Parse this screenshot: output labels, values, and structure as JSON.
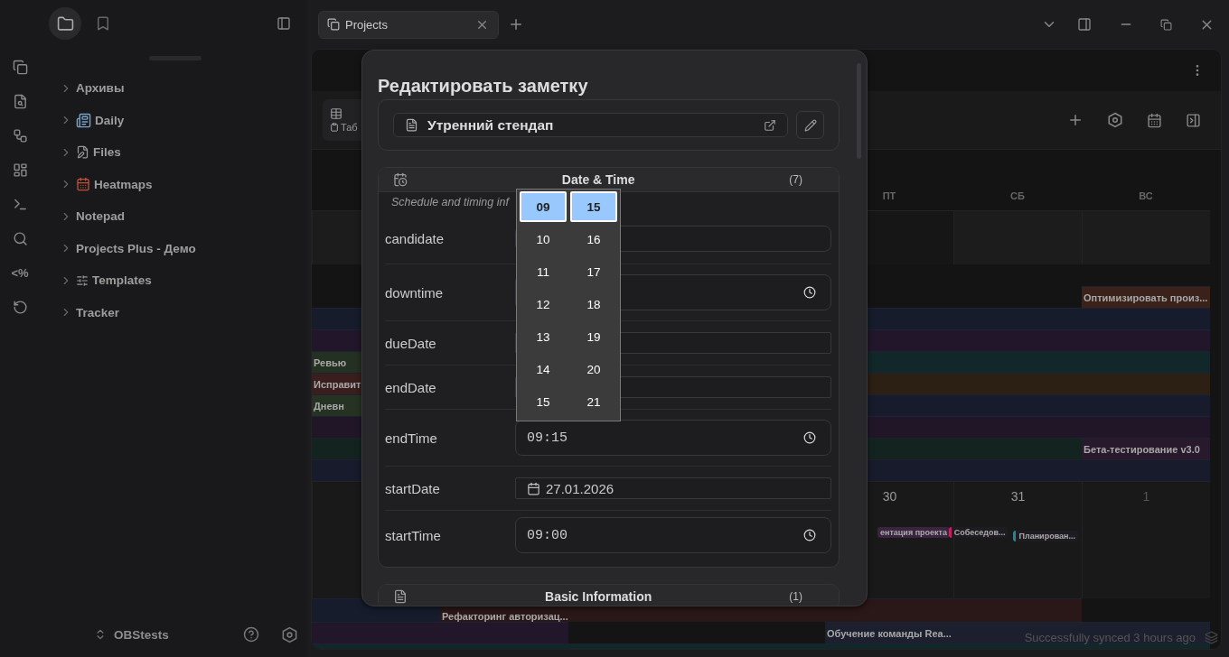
{
  "ribbon": {
    "template_glyph": "<%"
  },
  "sidebar": {
    "tabs": [
      {
        "kind": "files",
        "selected": true
      },
      {
        "kind": "bookmarks",
        "selected": false
      }
    ],
    "tree": [
      {
        "label": "Архивы",
        "kind": "plain",
        "expanded": false
      },
      {
        "label": "Daily",
        "kind": "daily",
        "expanded": false
      },
      {
        "label": "Files",
        "kind": "files",
        "expanded": false
      },
      {
        "label": "Heatmaps",
        "kind": "heatmap",
        "expanded": false
      },
      {
        "label": "Notepad",
        "kind": "plain",
        "expanded": false
      },
      {
        "label": "Projects Plus - Демо",
        "kind": "plain",
        "expanded": false
      },
      {
        "label": "Templates",
        "kind": "templates",
        "expanded": false
      },
      {
        "label": "Tracker",
        "kind": "plain",
        "expanded": false
      }
    ],
    "vault": "OBStests"
  },
  "tabs": [
    {
      "label": "Projects",
      "selected": true
    }
  ],
  "toolbar": {
    "view_label": "Таб"
  },
  "calendar": {
    "weekdays": [
      "ПТ",
      "СБ",
      "ВС"
    ],
    "lanes": [
      {
        "segments": [
          {
            "color": "#3a2119",
            "label": "Оптимизировать произ..."
          }
        ]
      },
      {
        "segments": [
          {
            "color": "#161c2b"
          }
        ]
      },
      {
        "segments": [
          {
            "color": "#21162a"
          }
        ]
      },
      {
        "segments": [
          {
            "color": "#243022",
            "label": "Ревью"
          },
          {
            "color": "#122729"
          }
        ]
      },
      {
        "segments": [
          {
            "color": "#3a1d1d",
            "label": "Исправит"
          },
          {
            "color": "#2c1f13"
          }
        ]
      },
      {
        "segments": [
          {
            "color": "#263322",
            "label": "Дневн"
          },
          {
            "color": "#171b2c"
          }
        ]
      },
      {
        "segments": [
          {
            "color": "#201628"
          }
        ]
      },
      {
        "segments": [
          {
            "color": "#132420"
          },
          {
            "color": "#28192c",
            "label": "Бета-тестирование v3.0"
          }
        ]
      },
      {
        "segments": [
          {
            "color": "#181b2c"
          }
        ]
      }
    ],
    "days": [
      {
        "label": "30",
        "other_month": false,
        "events": [
          {
            "label": "ентация проекта",
            "color": "#3a2440"
          }
        ]
      },
      {
        "label": "31",
        "other_month": false,
        "events": [
          {
            "label": "Собеседов...",
            "color": "#c0225a"
          },
          {
            "label": "Планирован...",
            "color": "#1a8a96"
          }
        ]
      },
      {
        "label": "1",
        "other_month": true
      }
    ],
    "bottom_lanes": [
      {
        "segments": [
          {
            "color": "#161c2c"
          },
          {
            "color": "#2a1717",
            "label": "Рефакторинг авторизац..."
          }
        ]
      },
      {
        "segments": [
          {
            "color": "#22172a"
          },
          {
            "color": "#1b1f2e",
            "label": "Обучение команды Rea..."
          }
        ]
      },
      {
        "segments": [
          {
            "color": "#11282a"
          }
        ]
      }
    ]
  },
  "modal": {
    "title": "Редактировать заметку",
    "note": {
      "name": "Утренний стендап"
    },
    "sections": [
      {
        "kind": "schedule",
        "title": "Date & Time",
        "count": "(7)",
        "subtitle": "Schedule and timing inf",
        "fields": [
          {
            "label": "candidate",
            "kind": "text"
          },
          {
            "label": "downtime",
            "kind": "time"
          },
          {
            "label": "dueDate",
            "kind": "date"
          },
          {
            "label": "endDate",
            "kind": "date"
          },
          {
            "label": "endTime",
            "kind": "time",
            "value": "09:15"
          },
          {
            "label": "startDate",
            "kind": "date",
            "value": "27.01.2026"
          },
          {
            "label": "startTime",
            "kind": "time",
            "value": "09:00"
          }
        ]
      },
      {
        "kind": "basic",
        "title": "Basic Information",
        "count": "(1)"
      }
    ]
  },
  "time_picker": {
    "hours": [
      {
        "label": "09",
        "selected": true
      },
      {
        "label": "10",
        "selected": false
      },
      {
        "label": "11",
        "selected": false
      },
      {
        "label": "12",
        "selected": false
      },
      {
        "label": "13",
        "selected": false
      },
      {
        "label": "14",
        "selected": false
      },
      {
        "label": "15",
        "selected": false
      }
    ],
    "minutes": [
      {
        "label": "15",
        "selected": true
      },
      {
        "label": "16",
        "selected": false
      },
      {
        "label": "17",
        "selected": false
      },
      {
        "label": "18",
        "selected": false
      },
      {
        "label": "19",
        "selected": false
      },
      {
        "label": "20",
        "selected": false
      },
      {
        "label": "21",
        "selected": false
      }
    ]
  },
  "status": "Successfully synced 3 hours ago"
}
